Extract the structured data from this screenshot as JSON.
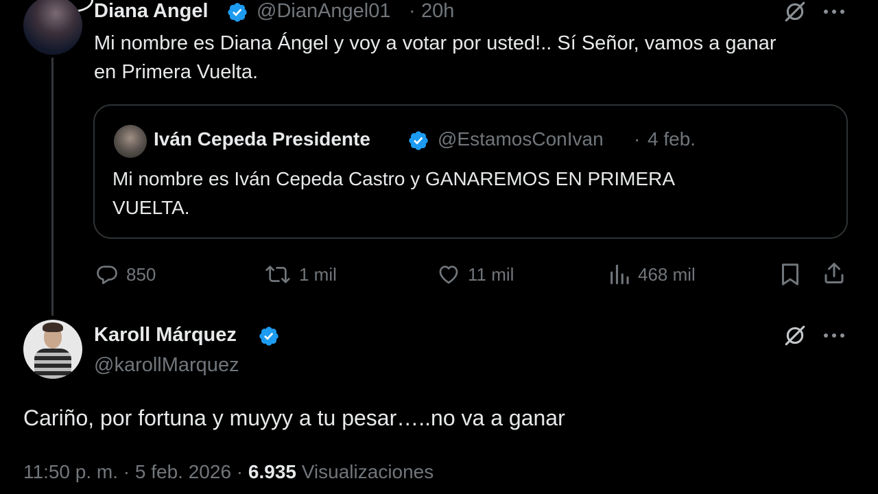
{
  "parent_tweet": {
    "author_name": "Diana Angel",
    "handle": "@DianAngel01",
    "separator": "·",
    "time": "20h",
    "text_line1": "Mi nombre es Diana Ángel y voy a votar por usted!.. Sí Señor, vamos a ganar",
    "text_line2": "en Primera Vuelta.",
    "quote": {
      "author_name": "Iván Cepeda Presidente",
      "handle": "@EstamosConIvan",
      "separator": "·",
      "time": "4 feb.",
      "text_line1": "Mi nombre es Iván Cepeda Castro y GANAREMOS EN PRIMERA",
      "text_line2": "VUELTA."
    },
    "actions": {
      "replies": "850",
      "reposts": "1 mil",
      "likes": "11 mil",
      "views": "468 mil"
    }
  },
  "reply_tweet": {
    "author_name": "Karoll Márquez",
    "handle": "@karollMarquez",
    "text": "Cariño, por fortuna y muyyy a tu pesar…..no va a ganar",
    "timestamp": "11:50 p. m. · 5 feb. 2026 · ",
    "views_count": "6.935",
    "views_label": " Visualizaciones"
  },
  "icons": {
    "verified": "verified-badge-icon",
    "grok": "grok-icon",
    "more": "more-icon",
    "reply": "reply-icon",
    "repost": "repost-icon",
    "like": "like-icon",
    "views": "views-icon",
    "bookmark": "bookmark-icon",
    "share": "share-icon"
  },
  "colors": {
    "background": "#000000",
    "text": "#e7e9ea",
    "muted": "#71767b",
    "verified": "#1d9bf0",
    "border": "#2f3336"
  }
}
